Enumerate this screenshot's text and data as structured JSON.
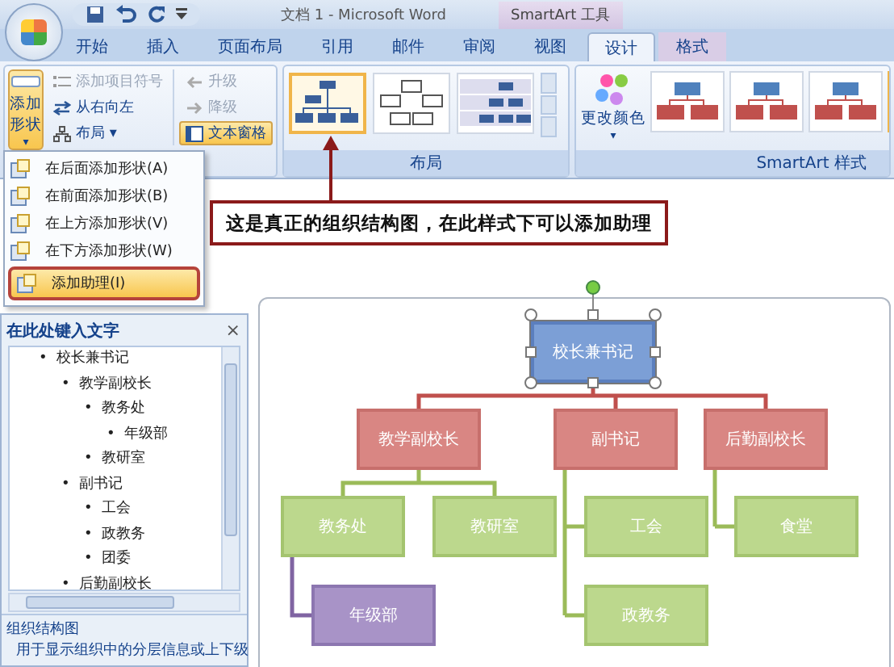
{
  "window": {
    "title": "文档 1 - Microsoft Word",
    "context_title": "SmartArt 工具"
  },
  "tabs": [
    {
      "label": "开始",
      "selected": false,
      "contextual": false
    },
    {
      "label": "插入",
      "selected": false,
      "contextual": false
    },
    {
      "label": "页面布局",
      "selected": false,
      "contextual": false
    },
    {
      "label": "引用",
      "selected": false,
      "contextual": false
    },
    {
      "label": "邮件",
      "selected": false,
      "contextual": false
    },
    {
      "label": "审阅",
      "selected": false,
      "contextual": false
    },
    {
      "label": "视图",
      "selected": false,
      "contextual": false
    },
    {
      "label": "设计",
      "selected": true,
      "contextual": true
    },
    {
      "label": "格式",
      "selected": false,
      "contextual": true
    }
  ],
  "ribbon": {
    "add_shape": {
      "label": "添加形状",
      "arrow": "▾",
      "pressed": true
    },
    "commands": [
      {
        "label": "添加项目符号",
        "disabled": true,
        "pressed": false
      },
      {
        "label": "从右向左",
        "disabled": false,
        "pressed": false
      },
      {
        "label": "布局 ▾",
        "disabled": false,
        "pressed": false
      },
      {
        "label": "升级",
        "disabled": true,
        "pressed": false
      },
      {
        "label": "降级",
        "disabled": true,
        "pressed": false
      },
      {
        "label": "文本窗格",
        "disabled": false,
        "pressed": true
      }
    ],
    "layout_group": {
      "label": "布局",
      "layouts": [
        {
          "kind": "org",
          "selected": true
        },
        {
          "kind": "outline",
          "selected": false
        },
        {
          "kind": "band",
          "selected": false
        }
      ]
    },
    "styles_group": {
      "label": "SmartArt 样式",
      "change_colors": "更改颜色",
      "change_colors_arrow": "▾",
      "styles": [
        {
          "selected": false
        },
        {
          "selected": false
        },
        {
          "selected": false
        },
        {
          "selected": true
        }
      ]
    }
  },
  "add_shape_menu": [
    {
      "label": "在后面添加形状(A)",
      "selected": false
    },
    {
      "label": "在前面添加形状(B)",
      "selected": false
    },
    {
      "label": "在上方添加形状(V)",
      "selected": false
    },
    {
      "label": "在下方添加形状(W)",
      "selected": false
    },
    {
      "label": "添加助理(I)",
      "selected": true
    }
  ],
  "callout": "这是真正的组织结构图，在此样式下可以添加助理",
  "text_pane": {
    "title": "在此处键入文字",
    "close": "×",
    "bullet": "•",
    "items": [
      {
        "label": "校长兼书记",
        "children": [
          {
            "label": "教学副校长",
            "children": [
              {
                "label": "教务处",
                "children": [
                  {
                    "label": "年级部"
                  }
                ]
              },
              {
                "label": "教研室"
              }
            ]
          },
          {
            "label": "副书记",
            "children": [
              {
                "label": "工会"
              },
              {
                "label": "政教务"
              },
              {
                "label": "团委"
              }
            ]
          },
          {
            "label": "后勤副校长"
          }
        ]
      }
    ],
    "description_title": "组织结构图",
    "description": "用于显示组织中的分层信息或上下级"
  },
  "diagram": {
    "label": "校长兼书记",
    "selected": true,
    "children": [
      {
        "label": "教学副校长",
        "children": [
          {
            "label": "教务处",
            "children": [
              {
                "label": "年级部"
              }
            ]
          },
          {
            "label": "教研室"
          }
        ]
      },
      {
        "label": "副书记",
        "children": [
          {
            "label": "工会"
          },
          {
            "label": "政教务"
          }
        ]
      },
      {
        "label": "后勤副校长",
        "children": [
          {
            "label": "食堂"
          }
        ]
      }
    ]
  }
}
